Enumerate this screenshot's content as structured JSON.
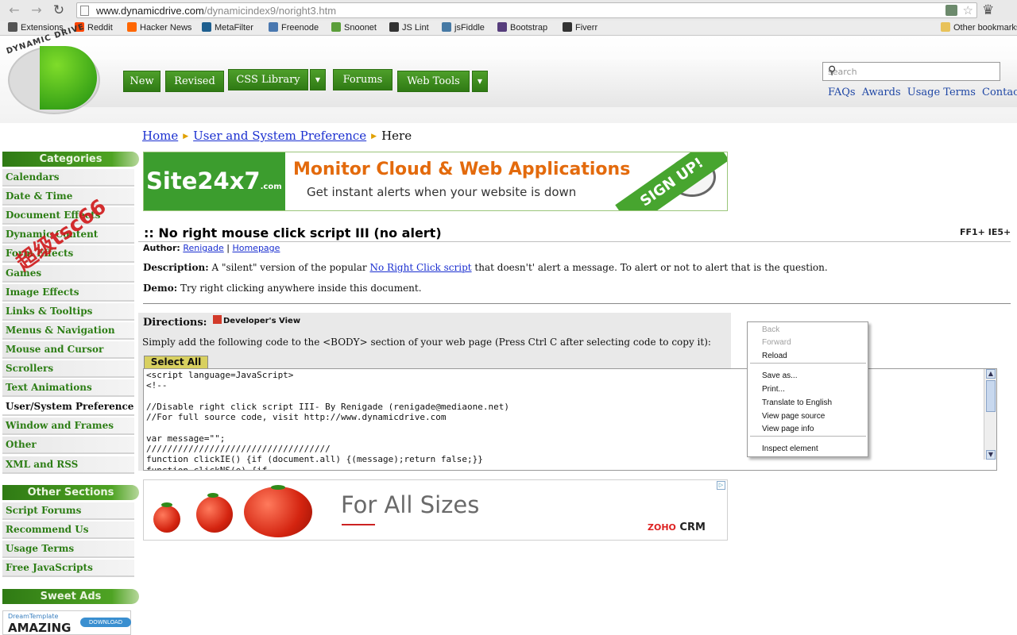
{
  "browser": {
    "url_host": "www.dynamicdrive.com",
    "url_path": "/dynamicindex9/noright3.htm",
    "bookmarks": [
      {
        "label": "Extensions",
        "color": "#555555"
      },
      {
        "label": "Reddit",
        "color": "#ff4500"
      },
      {
        "label": "Hacker News",
        "color": "#ff6600"
      },
      {
        "label": "MetaFilter",
        "color": "#1e5f8f"
      },
      {
        "label": "Freenode",
        "color": "#4a78b0"
      },
      {
        "label": "Snoonet",
        "color": "#5b9e3a"
      },
      {
        "label": "JS Lint",
        "color": "#333333"
      },
      {
        "label": "jsFiddle",
        "color": "#4679a4"
      },
      {
        "label": "Bootstrap",
        "color": "#563d7c"
      },
      {
        "label": "Fiverr",
        "color": "#333333"
      }
    ],
    "other_bookmarks": "Other bookmarks"
  },
  "site": {
    "logo_text": "DYNAMIC DRIVE",
    "nav": [
      "New",
      "Revised",
      "CSS Library",
      "Forums",
      "Web Tools"
    ],
    "search_placeholder": "search",
    "top_links": [
      "FAQs",
      "Awards",
      "Usage Terms",
      "Contact"
    ]
  },
  "breadcrumb": {
    "home": "Home",
    "category": "User and System Preference",
    "current": "Here"
  },
  "sidebar": {
    "categories_title": "Categories",
    "categories": [
      "Calendars",
      "Date & Time",
      "Document Effects",
      "Dynamic Content",
      "Form Effects",
      "Games",
      "Image Effects",
      "Links & Tooltips",
      "Menus & Navigation",
      "Mouse and Cursor",
      "Scrollers",
      "Text Animations",
      "User/System Preference",
      "Window and Frames",
      "Other",
      "XML and RSS"
    ],
    "active_category": "User/System Preference",
    "other_title": "Other Sections",
    "other": [
      "Script Forums",
      "Recommend Us",
      "Usage Terms",
      "Free JavaScripts"
    ],
    "sweet_title": "Sweet Ads",
    "sweet_ad": {
      "line1": "DreamTemplate",
      "line2": "AMAZING",
      "button": "DOWNLOAD"
    },
    "watermark": "超级tsc66"
  },
  "banner": {
    "brand": "Site24x7",
    "brand_suffix": ".com",
    "headline": "Monitor Cloud & Web Applications",
    "sub": "Get instant alerts when your website is down",
    "ribbon": "SIGN UP!"
  },
  "script": {
    "title": ":: No right mouse click script III (no alert)",
    "compat": "FF1+ IE5+",
    "author_label": "Author:",
    "author": "Renigade",
    "author_sep": "|",
    "homepage": "Homepage",
    "desc_label": "Description:",
    "desc_pre": "A \"silent\" version of the popular",
    "desc_link": "No Right Click script",
    "desc_post": "that doesn't' alert a message. To alert or not to alert that is the question.",
    "demo_label": "Demo:",
    "demo_text": "Try right clicking anywhere inside this document.",
    "directions_label": "Directions:",
    "dev_view": "Developer's View",
    "instructions": "Simply add the following code to the <BODY> section of your web page (Press Ctrl C after selecting code to copy it):",
    "select_all": "Select All",
    "code": "<script language=JavaScript>\n<!--\n\n//Disable right click script III- By Renigade (renigade@mediaone.net)\n//For full source code, visit http://www.dynamicdrive.com\n\nvar message=\"\";\n///////////////////////////////////\nfunction clickIE() {if (document.all) {(message);return false;}}\nfunction clickNS(e) {if"
  },
  "context_menu": {
    "items": [
      {
        "label": "Back",
        "enabled": false
      },
      {
        "label": "Forward",
        "enabled": false
      },
      {
        "label": "Reload",
        "enabled": true
      },
      {
        "label": "Save as...",
        "enabled": true
      },
      {
        "label": "Print...",
        "enabled": true
      },
      {
        "label": "Translate to English",
        "enabled": true
      },
      {
        "label": "View page source",
        "enabled": true
      },
      {
        "label": "View page info",
        "enabled": true
      },
      {
        "label": "Inspect element",
        "enabled": true
      }
    ]
  },
  "ad2": {
    "slogan": "For All Sizes",
    "brand": "ZOHO",
    "product": "CRM"
  }
}
